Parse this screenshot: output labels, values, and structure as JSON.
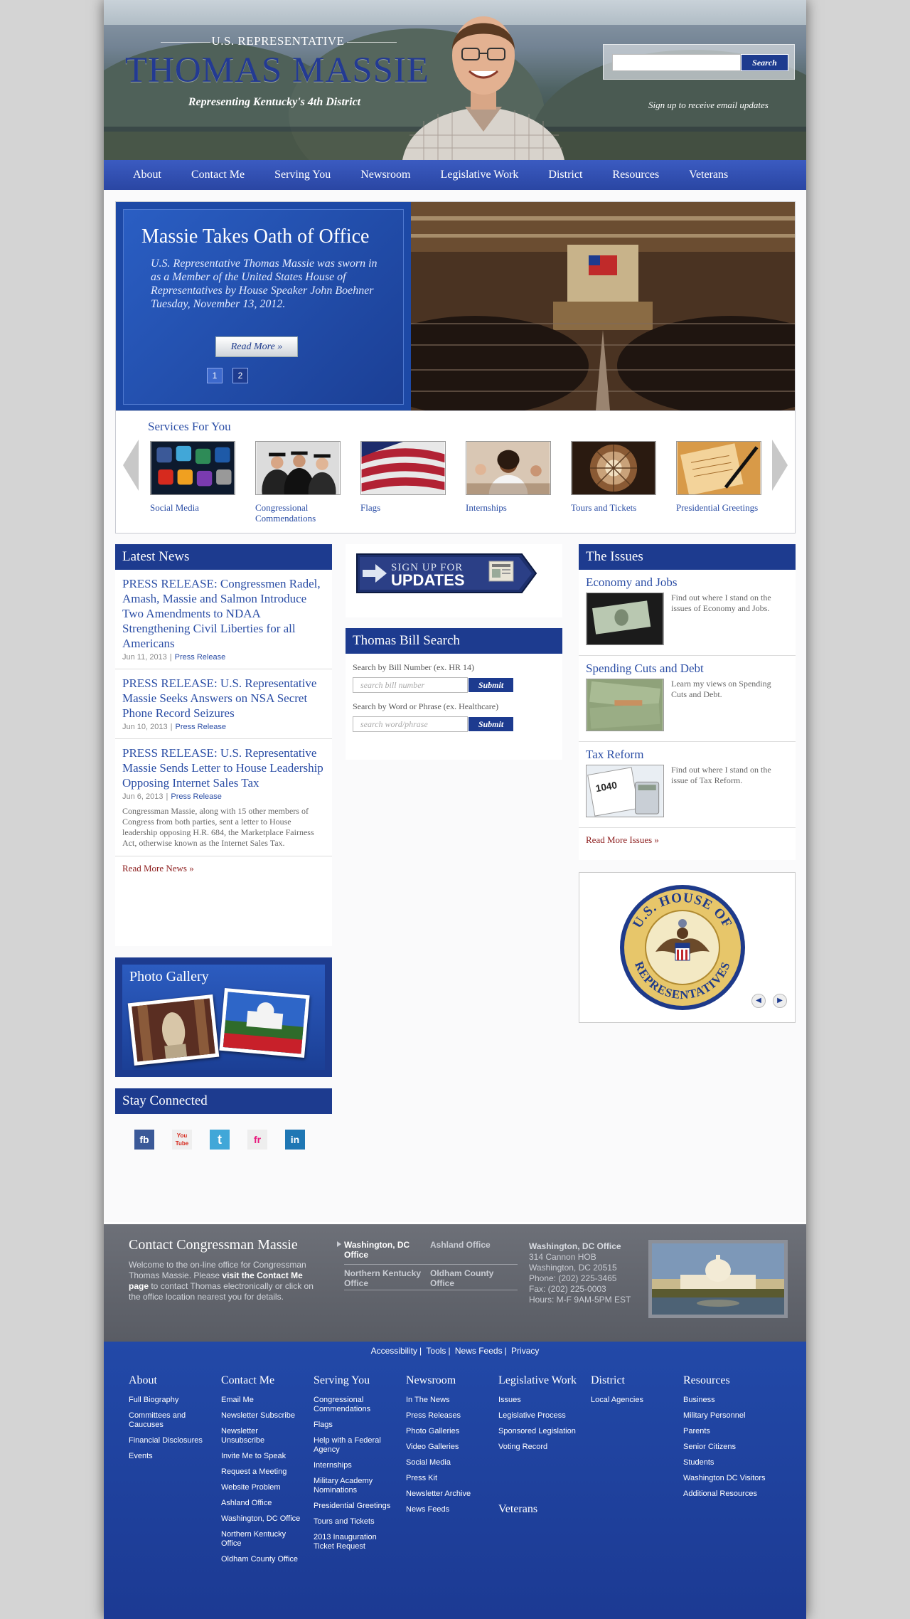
{
  "header": {
    "pre_title": "U.S. REPRESENTATIVE",
    "name": "THOMAS MASSIE",
    "tagline": "Representing Kentucky's 4th District",
    "search_button": "Search",
    "email_signup": "Sign up to receive email updates"
  },
  "nav": {
    "items": [
      "About",
      "Contact Me",
      "Serving You",
      "Newsroom",
      "Legislative Work",
      "District",
      "Resources",
      "Veterans"
    ]
  },
  "slider": {
    "title": "Massie Takes Oath of Office",
    "text": "U.S. Representative Thomas Massie was sworn in as a Member of the United States House of Representatives by House Speaker John Boehner Tuesday, November 13, 2012.",
    "read_more": "Read More »",
    "pages": [
      "1",
      "2"
    ]
  },
  "services": {
    "heading": "Services For You",
    "items": [
      {
        "label": "Social Media"
      },
      {
        "label": "Congressional Commendations"
      },
      {
        "label": "Flags"
      },
      {
        "label": "Internships"
      },
      {
        "label": "Tours and Tickets"
      },
      {
        "label": "Presidential Greetings"
      }
    ]
  },
  "latest_news": {
    "heading": "Latest News",
    "items": [
      {
        "title": "PRESS RELEASE: Congressmen Radel, Amash, Massie and Salmon Introduce Two Amendments to NDAA Strengthening Civil Liberties for all Americans",
        "date": "Jun 11, 2013",
        "category": "Press Release"
      },
      {
        "title": "PRESS RELEASE: U.S. Representative Massie Seeks Answers on NSA Secret Phone Record Seizures",
        "date": "Jun 10, 2013",
        "category": "Press Release"
      },
      {
        "title": "PRESS RELEASE: U.S. Representative Massie Sends Letter to House Leadership Opposing Internet Sales Tax",
        "date": "Jun 6, 2013",
        "category": "Press Release",
        "body": "Congressman Massie, along with 15 other members of Congress from both parties, sent a letter to House leadership opposing H.R. 684, the Marketplace Fairness Act, otherwise known as the Internet Sales Tax."
      }
    ],
    "more": "Read More News »"
  },
  "photo_gallery": {
    "heading": "Photo Gallery"
  },
  "stay_connected": {
    "heading": "Stay Connected",
    "icons": [
      {
        "glyph": "fb",
        "color": "#3b5998"
      },
      {
        "glyph": "You Tube",
        "color": "#d62a1e"
      },
      {
        "glyph": "t",
        "color": "#41a7d8"
      },
      {
        "glyph": "fr",
        "color": "#e8197d"
      },
      {
        "glyph": "in",
        "color": "#1f77b4"
      }
    ]
  },
  "signup": {
    "line1": "SIGN UP FOR",
    "line2": "UPDATES"
  },
  "bill_search": {
    "heading": "Thomas Bill Search",
    "label_number": "Search by Bill Number (ex. HR 14)",
    "placeholder_number": "search bill number",
    "label_word": "Search by Word or Phrase (ex. Healthcare)",
    "placeholder_word": "search word/phrase",
    "submit": "Submit"
  },
  "issues": {
    "heading": "The Issues",
    "items": [
      {
        "title": "Economy and Jobs",
        "text": "Find out where I stand on the issues of Economy and Jobs."
      },
      {
        "title": "Spending Cuts and Debt",
        "text": "Learn my views on Spending Cuts and Debt."
      },
      {
        "title": "Tax Reform",
        "text": "Find out where I stand on the issue of Tax Reform."
      }
    ],
    "more": "Read More Issues »"
  },
  "seal": {
    "text_top": "U.S. HOUSE OF",
    "text_bottom": "REPRESENTATIVES"
  },
  "contact": {
    "title": "Contact Congressman Massie",
    "text_before": "Welcome to the on-line office for Congressman Thomas Massie. Please ",
    "text_bold": "visit the Contact Me page",
    "text_after": " to contact Thomas electronically or click on the office location nearest you for details.",
    "offices": [
      "Washington, DC Office",
      "Ashland Office",
      "Northern Kentucky Office",
      "Oldham County Office"
    ],
    "address": {
      "title": "Washington, DC Office",
      "line1": "314 Cannon HOB",
      "line2": "Washington, DC 20515",
      "phone": "Phone: (202) 225-3465",
      "fax": "Fax: (202) 225-0003",
      "hours": "Hours: M-F 9AM-5PM EST"
    }
  },
  "footer": {
    "utility": [
      "Accessibility",
      "Tools",
      "News Feeds",
      "Privacy"
    ],
    "columns": [
      {
        "title": "About",
        "links": [
          "Full Biography",
          "Committees and Caucuses",
          "Financial Disclosures",
          "Events"
        ]
      },
      {
        "title": "Contact Me",
        "links": [
          "Email Me",
          "Newsletter Subscribe",
          "Newsletter Unsubscribe",
          "Invite Me to Speak",
          "Request a Meeting",
          "Website Problem",
          "Ashland Office",
          "Washington, DC Office",
          "Northern Kentucky Office",
          "Oldham County Office"
        ]
      },
      {
        "title": "Serving You",
        "links": [
          "Congressional Commendations",
          "Flags",
          "Help with a Federal Agency",
          "Internships",
          "Military Academy Nominations",
          "Presidential Greetings",
          "Tours and Tickets",
          "2013 Inauguration Ticket Request"
        ]
      },
      {
        "title": "Newsroom",
        "links": [
          "In The News",
          "Press Releases",
          "Photo Galleries",
          "Video Galleries",
          "Social Media",
          "Press Kit",
          "Newsletter Archive",
          "News Feeds"
        ]
      },
      {
        "title": "Legislative Work",
        "links": [
          "Issues",
          "Legislative Process",
          "Sponsored Legislation",
          "Voting Record"
        ]
      },
      {
        "title": "District",
        "links": [
          "Local Agencies"
        ]
      },
      {
        "title": "Resources",
        "links": [
          "Business",
          "Military Personnel",
          "Parents",
          "Senior Citizens",
          "Students",
          "Washington DC Visitors",
          "Additional Resources"
        ]
      }
    ],
    "veterans": "Veterans"
  }
}
